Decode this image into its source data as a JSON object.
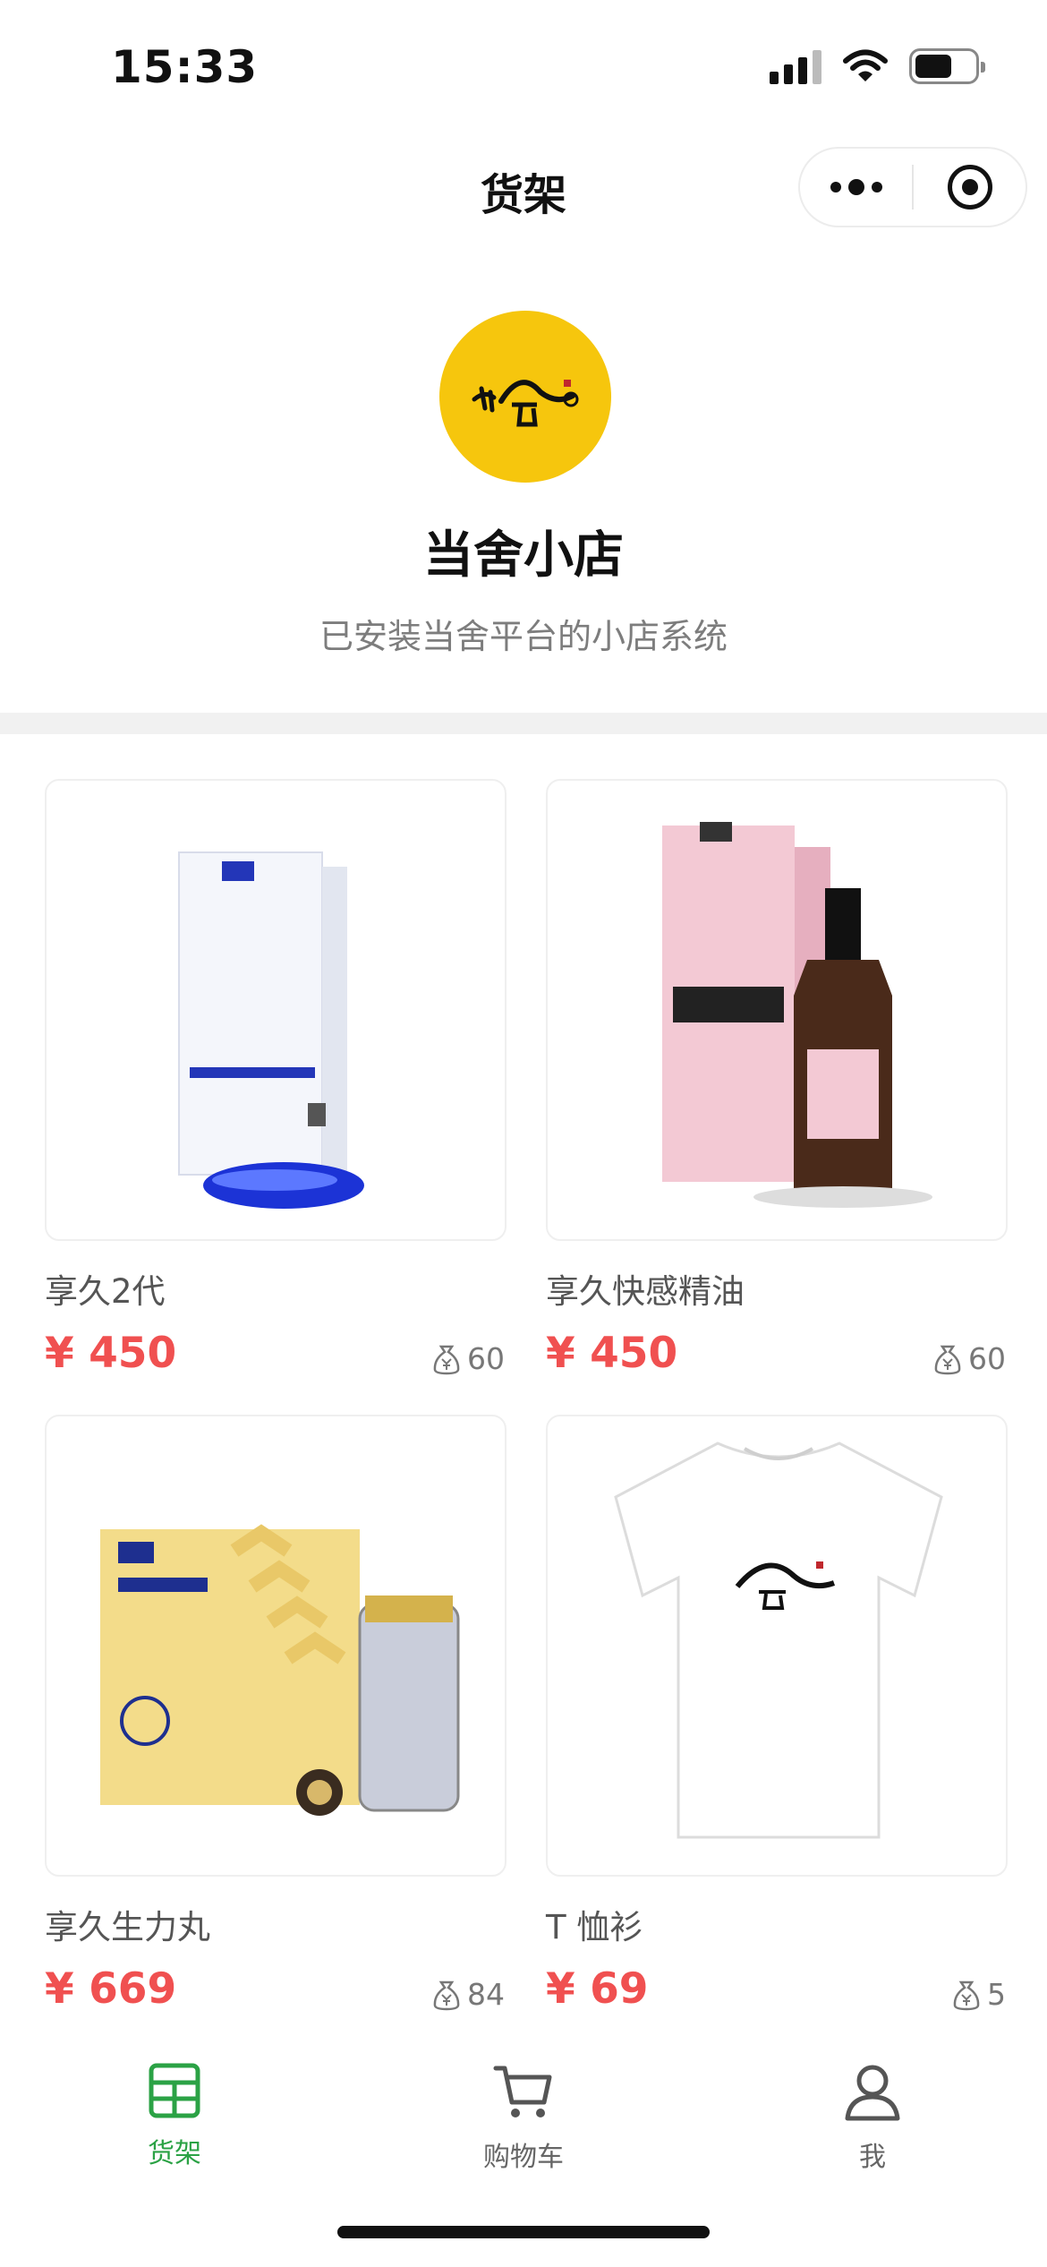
{
  "status_bar": {
    "time": "15:33"
  },
  "nav": {
    "title": "货架",
    "more_icon": "more-dots-icon",
    "close_icon": "target-icon"
  },
  "shop": {
    "name": "当舍小店",
    "description": "已安装当舍平台的小店系统",
    "logo_color": "#f6c60d"
  },
  "currency": "¥",
  "products": [
    {
      "title": "享久2代",
      "price": "¥ 450",
      "sales": "60"
    },
    {
      "title": "享久快感精油",
      "price": "¥ 450",
      "sales": "60"
    },
    {
      "title": "享久生力丸",
      "price": "¥ 669",
      "sales": "84"
    },
    {
      "title": "T 恤衫",
      "price": "¥ 69",
      "sales": "5"
    }
  ],
  "tabs": [
    {
      "label": "货架",
      "icon": "shelf-icon",
      "active": true
    },
    {
      "label": "购物车",
      "icon": "cart-icon",
      "active": false
    },
    {
      "label": "我",
      "icon": "person-icon",
      "active": false
    }
  ],
  "colors": {
    "price": "#f05050",
    "active_tab": "#2ba245",
    "divider": "#f1f1f1"
  }
}
